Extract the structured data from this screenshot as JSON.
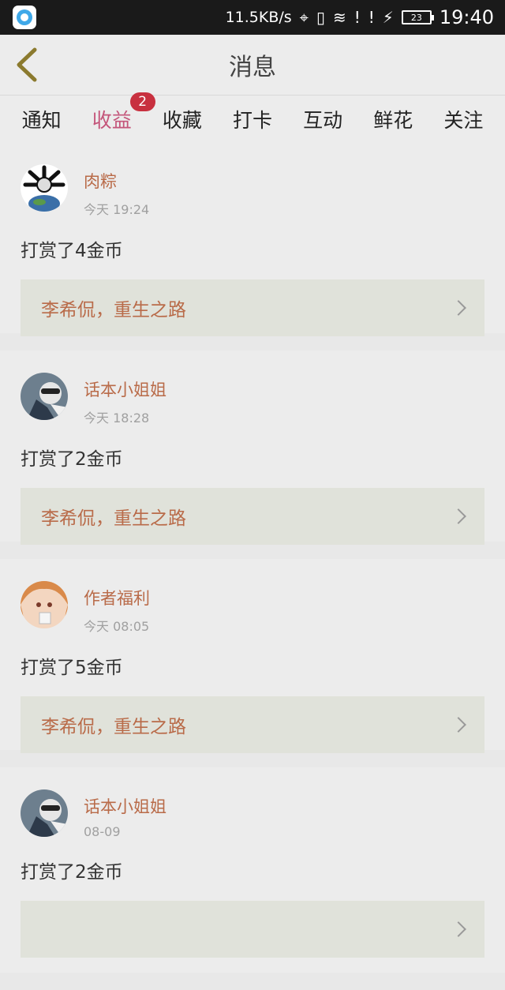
{
  "status_bar": {
    "speed": "11.5KB/s",
    "battery": "23",
    "time": "19:40"
  },
  "header": {
    "title": "消息"
  },
  "tabs": [
    {
      "label": "通知"
    },
    {
      "label": "收益",
      "badge": "2",
      "active": true
    },
    {
      "label": "收藏"
    },
    {
      "label": "打卡"
    },
    {
      "label": "互动"
    },
    {
      "label": "鲜花"
    },
    {
      "label": "关注"
    }
  ],
  "feed": [
    {
      "user": "肉粽",
      "time": "今天 19:24",
      "reward": "打赏了4金币",
      "book": "李希侃，重生之路"
    },
    {
      "user": "话本小姐姐",
      "time": "今天 18:28",
      "reward": "打赏了2金币",
      "book": "李希侃，重生之路"
    },
    {
      "user": "作者福利",
      "time": "今天 08:05",
      "reward": "打赏了5金币",
      "book": "李希侃，重生之路"
    },
    {
      "user": "话本小姐姐",
      "time": "08-09",
      "reward": "打赏了2金币",
      "book": ""
    }
  ],
  "colors": {
    "accent": "#c4557a",
    "name": "#b96b49",
    "badge": "#c8303f"
  }
}
